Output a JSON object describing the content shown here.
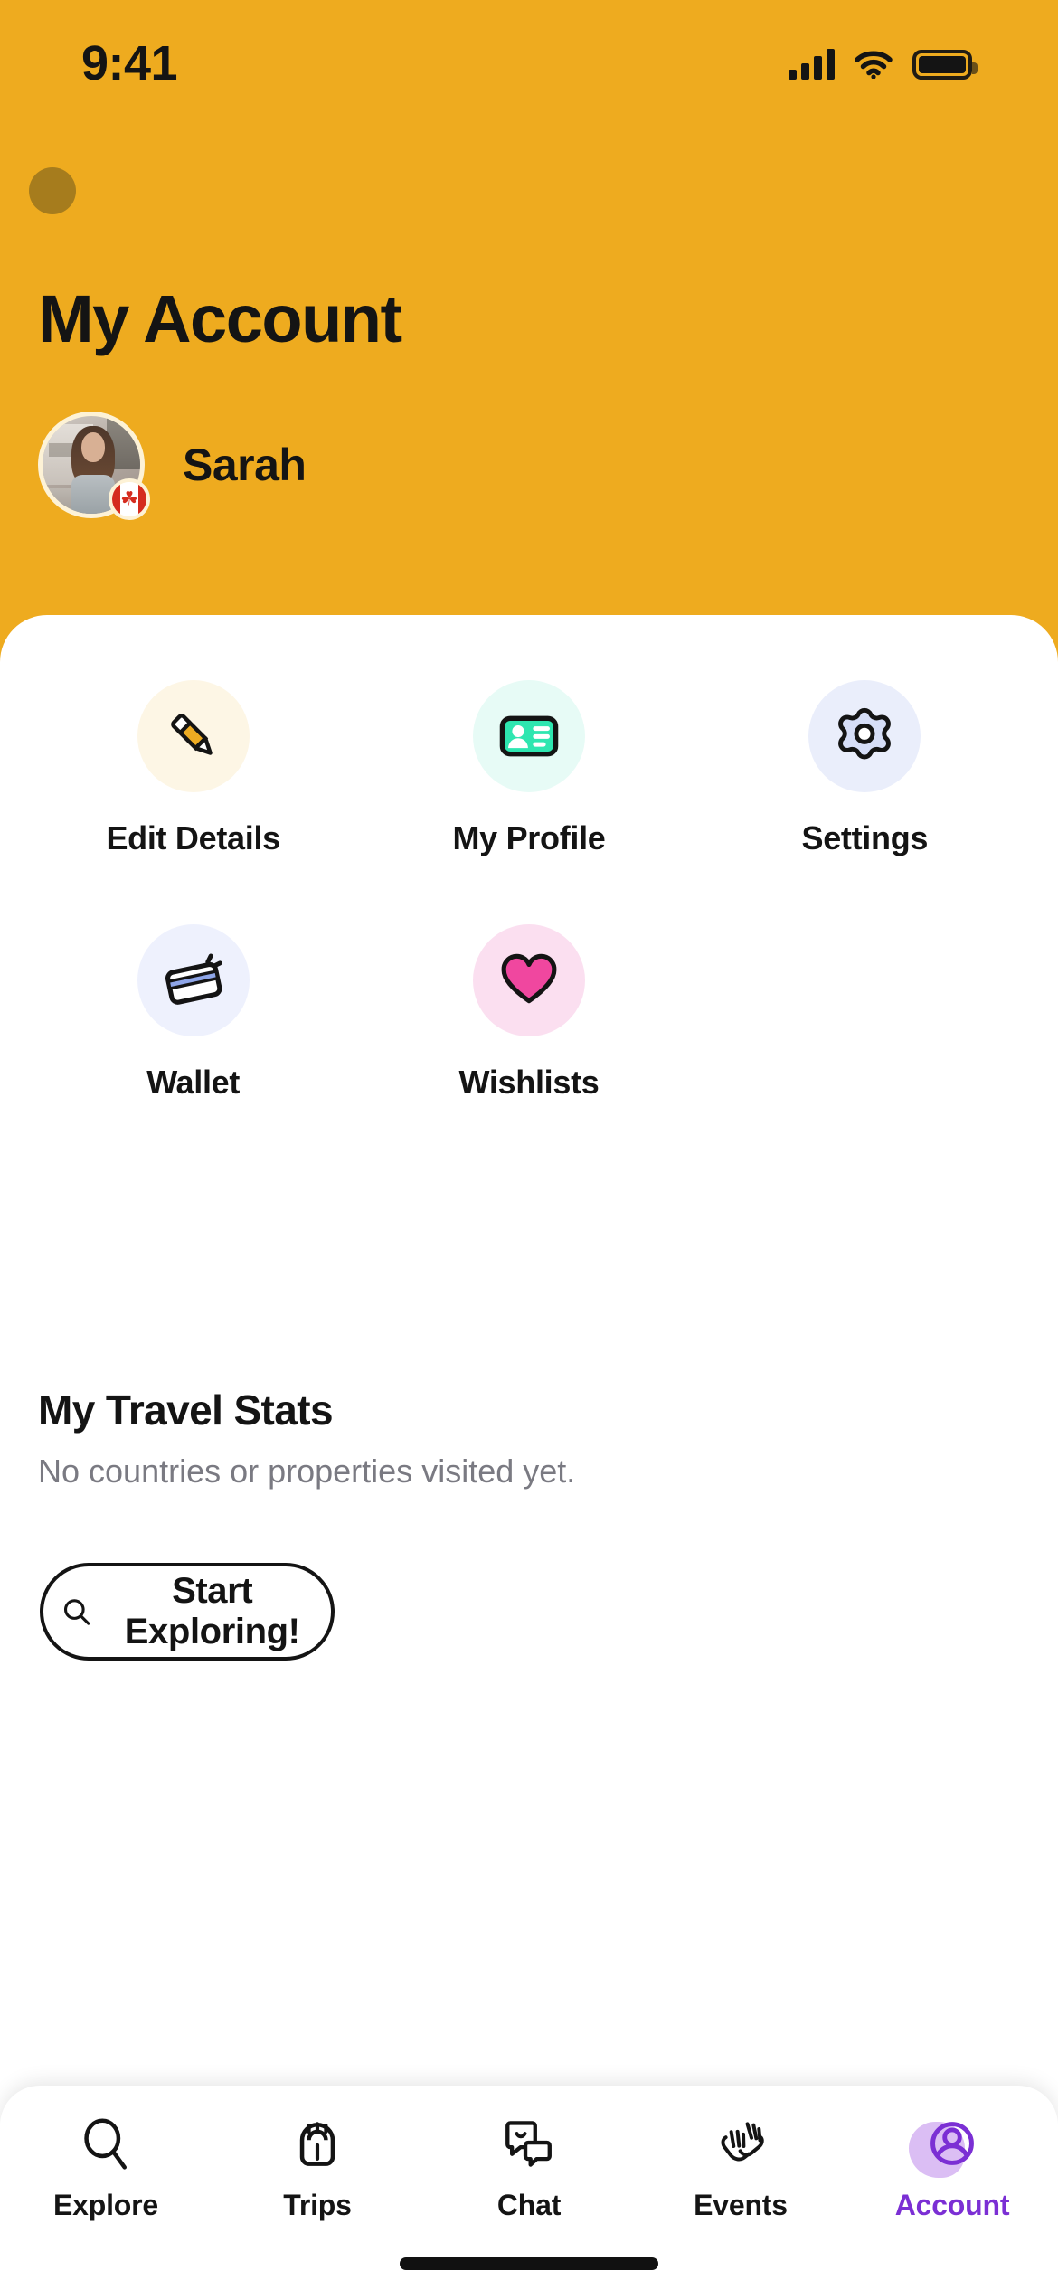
{
  "theme": {
    "header_bg": "#eeab1f",
    "sheet_bg": "#ffffff",
    "accent_purple": "#7b2fd4",
    "text_primary": "#141414",
    "text_muted": "#7a7a82"
  },
  "status_bar": {
    "time": "9:41",
    "signal_icon": "cellular-signal-icon",
    "wifi_icon": "wifi-icon",
    "battery_icon": "battery-full-icon"
  },
  "header": {
    "brand_dot": "brand-dot",
    "title": "My Account",
    "profile": {
      "name": "Sarah",
      "avatar_alt": "user-avatar",
      "flag_badge": "canada-flag-badge",
      "flag_glyph": "☘"
    }
  },
  "actions": [
    {
      "id": "edit-details",
      "label": "Edit Details",
      "icon": "pencil-icon",
      "bubble_color": "#fdf6e5",
      "icon_color": "#edab22"
    },
    {
      "id": "my-profile",
      "label": "My Profile",
      "icon": "id-card-icon",
      "bubble_color": "#e7fbf6",
      "icon_color": "#2ee6b0"
    },
    {
      "id": "settings",
      "label": "Settings",
      "icon": "gear-icon",
      "bubble_color": "#eaeefb",
      "icon_color": "#d6def7"
    },
    {
      "id": "wallet",
      "label": "Wallet",
      "icon": "credit-card-icon",
      "bubble_color": "#eef1fd",
      "icon_color": "#8fa6e8"
    },
    {
      "id": "wishlists",
      "label": "Wishlists",
      "icon": "heart-icon",
      "bubble_color": "#fbdff0",
      "icon_color": "#f0479f"
    }
  ],
  "travel_stats": {
    "title": "My Travel Stats",
    "empty_message": "No countries or properties visited yet.",
    "cta_label": "Start Exploring!",
    "cta_icon": "search-icon"
  },
  "tabbar": {
    "items": [
      {
        "id": "explore",
        "label": "Explore",
        "icon": "search-icon",
        "active": false
      },
      {
        "id": "trips",
        "label": "Trips",
        "icon": "backpack-icon",
        "active": false
      },
      {
        "id": "chat",
        "label": "Chat",
        "icon": "chat-bubbles-icon",
        "active": false
      },
      {
        "id": "events",
        "label": "Events",
        "icon": "waving-hands-icon",
        "active": false
      },
      {
        "id": "account",
        "label": "Account",
        "icon": "user-circle-icon",
        "active": true
      }
    ]
  }
}
